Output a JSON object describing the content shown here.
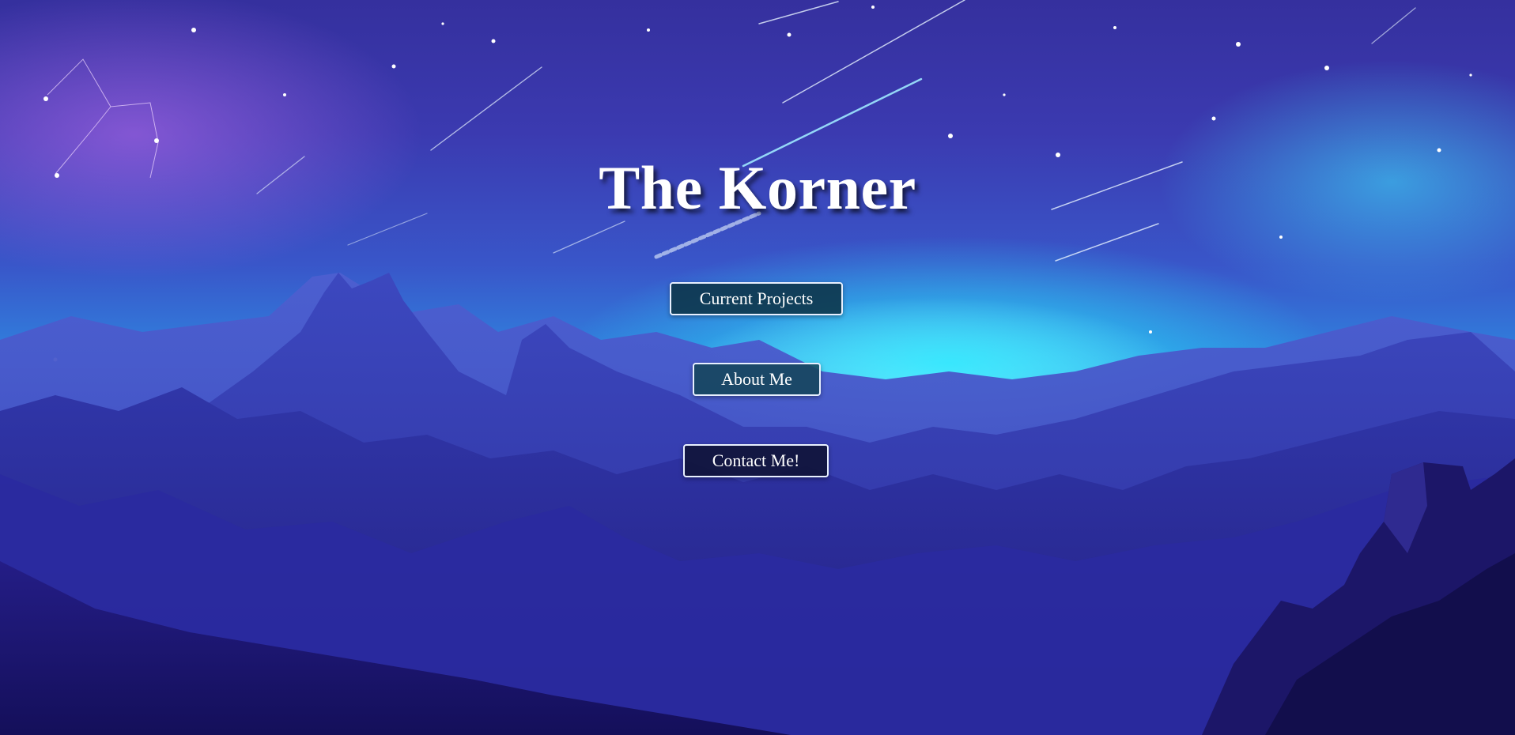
{
  "page": {
    "title": "The Korner"
  },
  "nav": {
    "buttons": [
      {
        "label": "Current Projects"
      },
      {
        "label": "About Me"
      },
      {
        "label": "Contact Me!"
      }
    ]
  },
  "background": {
    "scene": "starry-night-mountains",
    "colors": {
      "sky_top": "#35309e",
      "glow_cyan": "#28ebff",
      "nebula_purple": "#be6ef0",
      "mountains_deep": "#1c1670"
    }
  }
}
